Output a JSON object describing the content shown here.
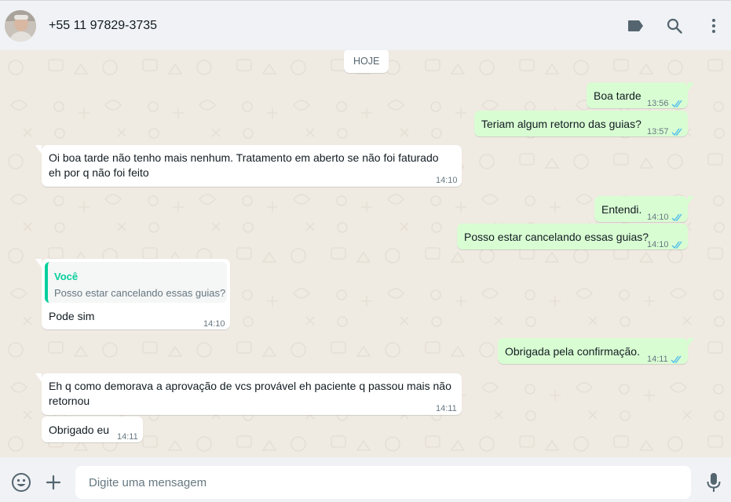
{
  "header": {
    "contact_name": "+55 11 97829-3735",
    "icons": [
      "label-icon",
      "search-icon",
      "menu-icon"
    ]
  },
  "chat": {
    "date_divider": "HOJE",
    "messages": [
      {
        "direction": "out",
        "text": "Boa tarde",
        "time": "13:56",
        "status": "read"
      },
      {
        "direction": "out",
        "text": "Teriam algum retorno das guias?",
        "time": "13:57",
        "status": "read"
      },
      {
        "direction": "in",
        "text_lines": [
          "Oi boa tarde não tenho mais nenhum. Tratamento em aberto se não foi faturado",
          "eh por q não foi feito"
        ],
        "time": "14:10"
      },
      {
        "direction": "out",
        "text": "Entendi.",
        "time": "14:10",
        "status": "read"
      },
      {
        "direction": "out",
        "text": "Posso estar cancelando essas guias?",
        "time": "14:10",
        "status": "read"
      },
      {
        "direction": "in",
        "quote": {
          "author": "Você",
          "text": "Posso estar cancelando essas guias?"
        },
        "text": "Pode sim",
        "time": "14:10"
      },
      {
        "direction": "out",
        "text": "Obrigada pela confirmação.",
        "time": "14:11",
        "status": "read"
      },
      {
        "direction": "in",
        "text_lines": [
          "Eh q como demorava a aprovação de vcs provável eh paciente q passou mais não",
          "retornou"
        ],
        "time": "14:11"
      },
      {
        "direction": "in",
        "text": "Obrigado eu",
        "time": "14:11"
      }
    ]
  },
  "footer": {
    "placeholder": "Digite uma mensagem",
    "icons": [
      "emoji-icon",
      "attach-plus-icon",
      "microphone-icon"
    ]
  },
  "colors": {
    "outgoing_bubble": "#d9fdd3",
    "incoming_bubble": "#ffffff",
    "chat_background": "#efeae2",
    "read_tick": "#53bdeb",
    "quote_accent": "#06cf9c"
  }
}
